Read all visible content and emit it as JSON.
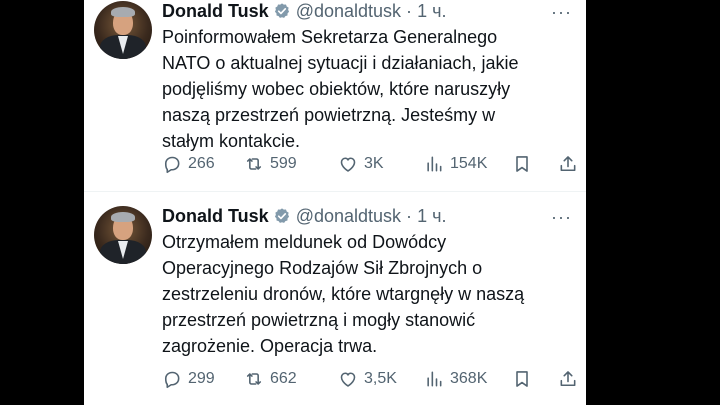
{
  "colors": {
    "background": "#000000",
    "feed": "#ffffff",
    "text": "#0f1419",
    "secondary": "#536471",
    "verified": "#829aab"
  },
  "tweets": [
    {
      "author": "Donald Tusk",
      "handle": "@donaldtusk",
      "separator": "·",
      "time": "1 ч.",
      "text": "Poinformowałem Sekretarza Generalnego\nNATO o aktualnej sytuacji i działaniach, jakie\npodjęliśmy wobec obiektów, które naruszyły\nnaszą przestrzeń powietrzną. Jesteśmy w\nstałym kontakcie.",
      "replies": "266",
      "reposts": "599",
      "likes": "3K",
      "views": "154K"
    },
    {
      "author": "Donald Tusk",
      "handle": "@donaldtusk",
      "separator": "·",
      "time": "1 ч.",
      "text": "Otrzymałem meldunek od Dowódcy\nOperacyjnego Rodzajów Sił Zbrojnych o\nzestrzeleniu dronów, które wtargnęły w naszą\nprzestrzeń powietrzną i mogły stanowić\nzagrożenie. Operacja trwa.",
      "replies": "299",
      "reposts": "662",
      "likes": "3,5K",
      "views": "368K"
    }
  ],
  "icons": {
    "more": "more-icon",
    "reply": "reply-icon",
    "repost": "repost-icon",
    "like": "heart-icon",
    "views": "views-icon",
    "bookmark": "bookmark-icon",
    "share": "share-icon",
    "verified": "verified-badge-icon"
  }
}
